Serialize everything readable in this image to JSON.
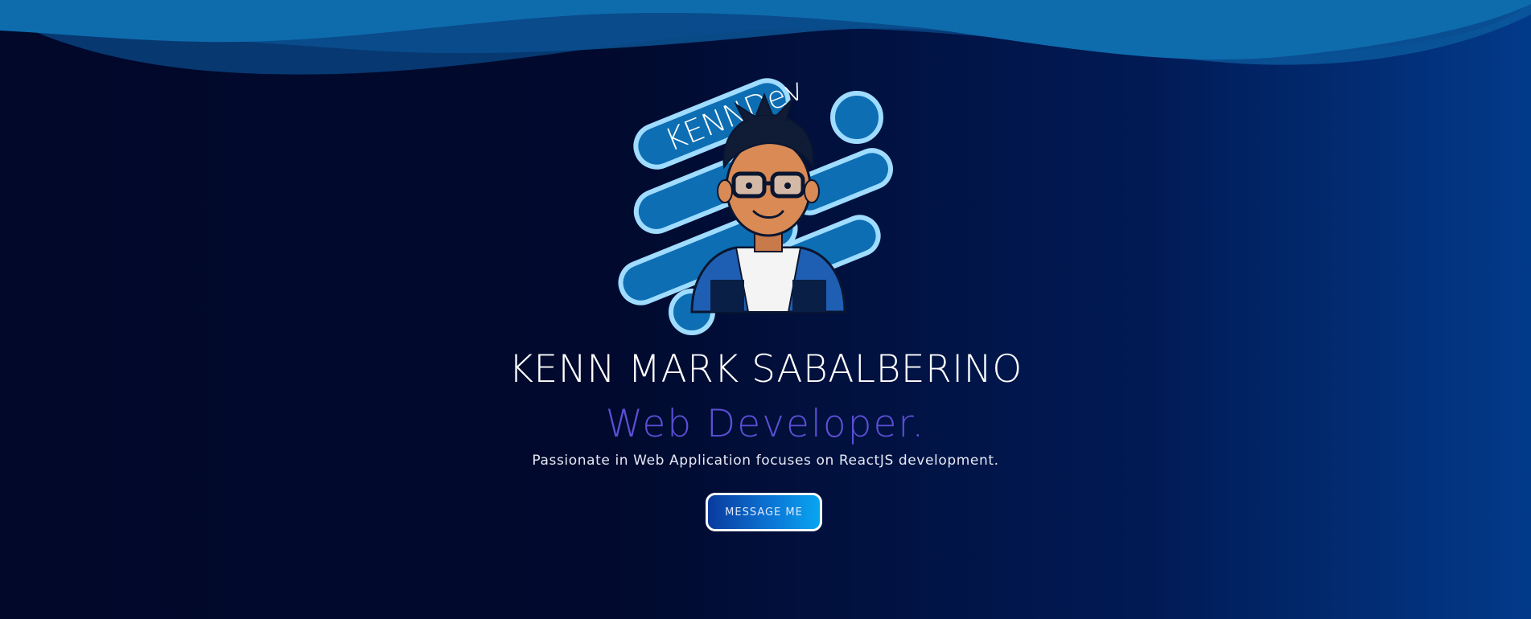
{
  "hero": {
    "logo_text": "KENNDev",
    "name": "KENN MARK SABALBERINO",
    "role": "Web Developer.",
    "tagline": "Passionate in Web Application focuses on ReactJS development.",
    "cta_label": "MESSAGE ME"
  },
  "colors": {
    "background_dark": "#01082a",
    "background_right": "#023a8a",
    "wave": "#0d6fb0",
    "role_text": "#5b4fd6",
    "button_gradient_start": "#0a3b9e",
    "button_gradient_end": "#08a6f0"
  }
}
